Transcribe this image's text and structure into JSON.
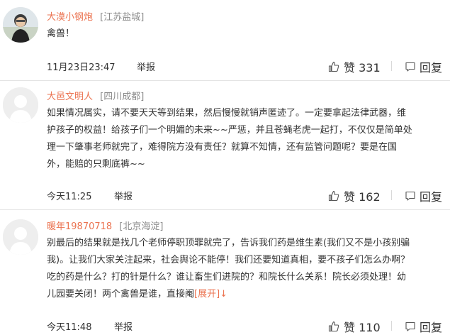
{
  "comments": [
    {
      "username": "大漠小钢炮",
      "location": "[江苏盐城]",
      "text": "禽兽！",
      "time": "11月23日23:47",
      "report": "举报",
      "likes": "赞 331",
      "reply": "回复"
    },
    {
      "username": "大邑文明人",
      "location": "[四川成都]",
      "text_lines": [
        "如果情况属实，请不要天天等到结果，然后慢慢就销声匿迹了。一定要拿起法律武器，维",
        "护孩子的权益！给孩子们一个明媚的未来~~严惩，并且苍蝇老虎一起打，不仅仅是简单处",
        "理一下肇事老师就完了，难得院方没有责任？就算不知情，还有监管问题呢？要是在国",
        "外，能赔的只剩底裤~~"
      ],
      "time": "今天11:25",
      "report": "举报",
      "likes": "赞 162",
      "reply": "回复"
    },
    {
      "username": "暖年19870718",
      "location": "[北京海淀]",
      "text_lines": [
        "别最后的结果就是找几个老师停职顶罪就完了，告诉我们药是维生素(我们又不是小孩别骗",
        "我)。让我们大家关注起来，社会舆论不能停！我们还要知道真相，要不孩子们怎么办啊？",
        "吃的药是什么？打的针是什么？谁让畜生们进院的？和院长什么关系！院长必须处理！幼",
        "儿园要关闭！两个禽兽是谁，直接阉"
      ],
      "expand": "[展开]↓",
      "time": "今天11:48",
      "report": "举报",
      "likes": "赞 110",
      "reply": "回复"
    }
  ],
  "colors": {
    "username": "#eb7350",
    "location": "#8a8a8a",
    "text": "#333333",
    "divider": "#e4e4e4"
  },
  "icons": [
    "thumbs-up-icon",
    "reply-bubble-icon",
    "default-avatar-icon"
  ]
}
